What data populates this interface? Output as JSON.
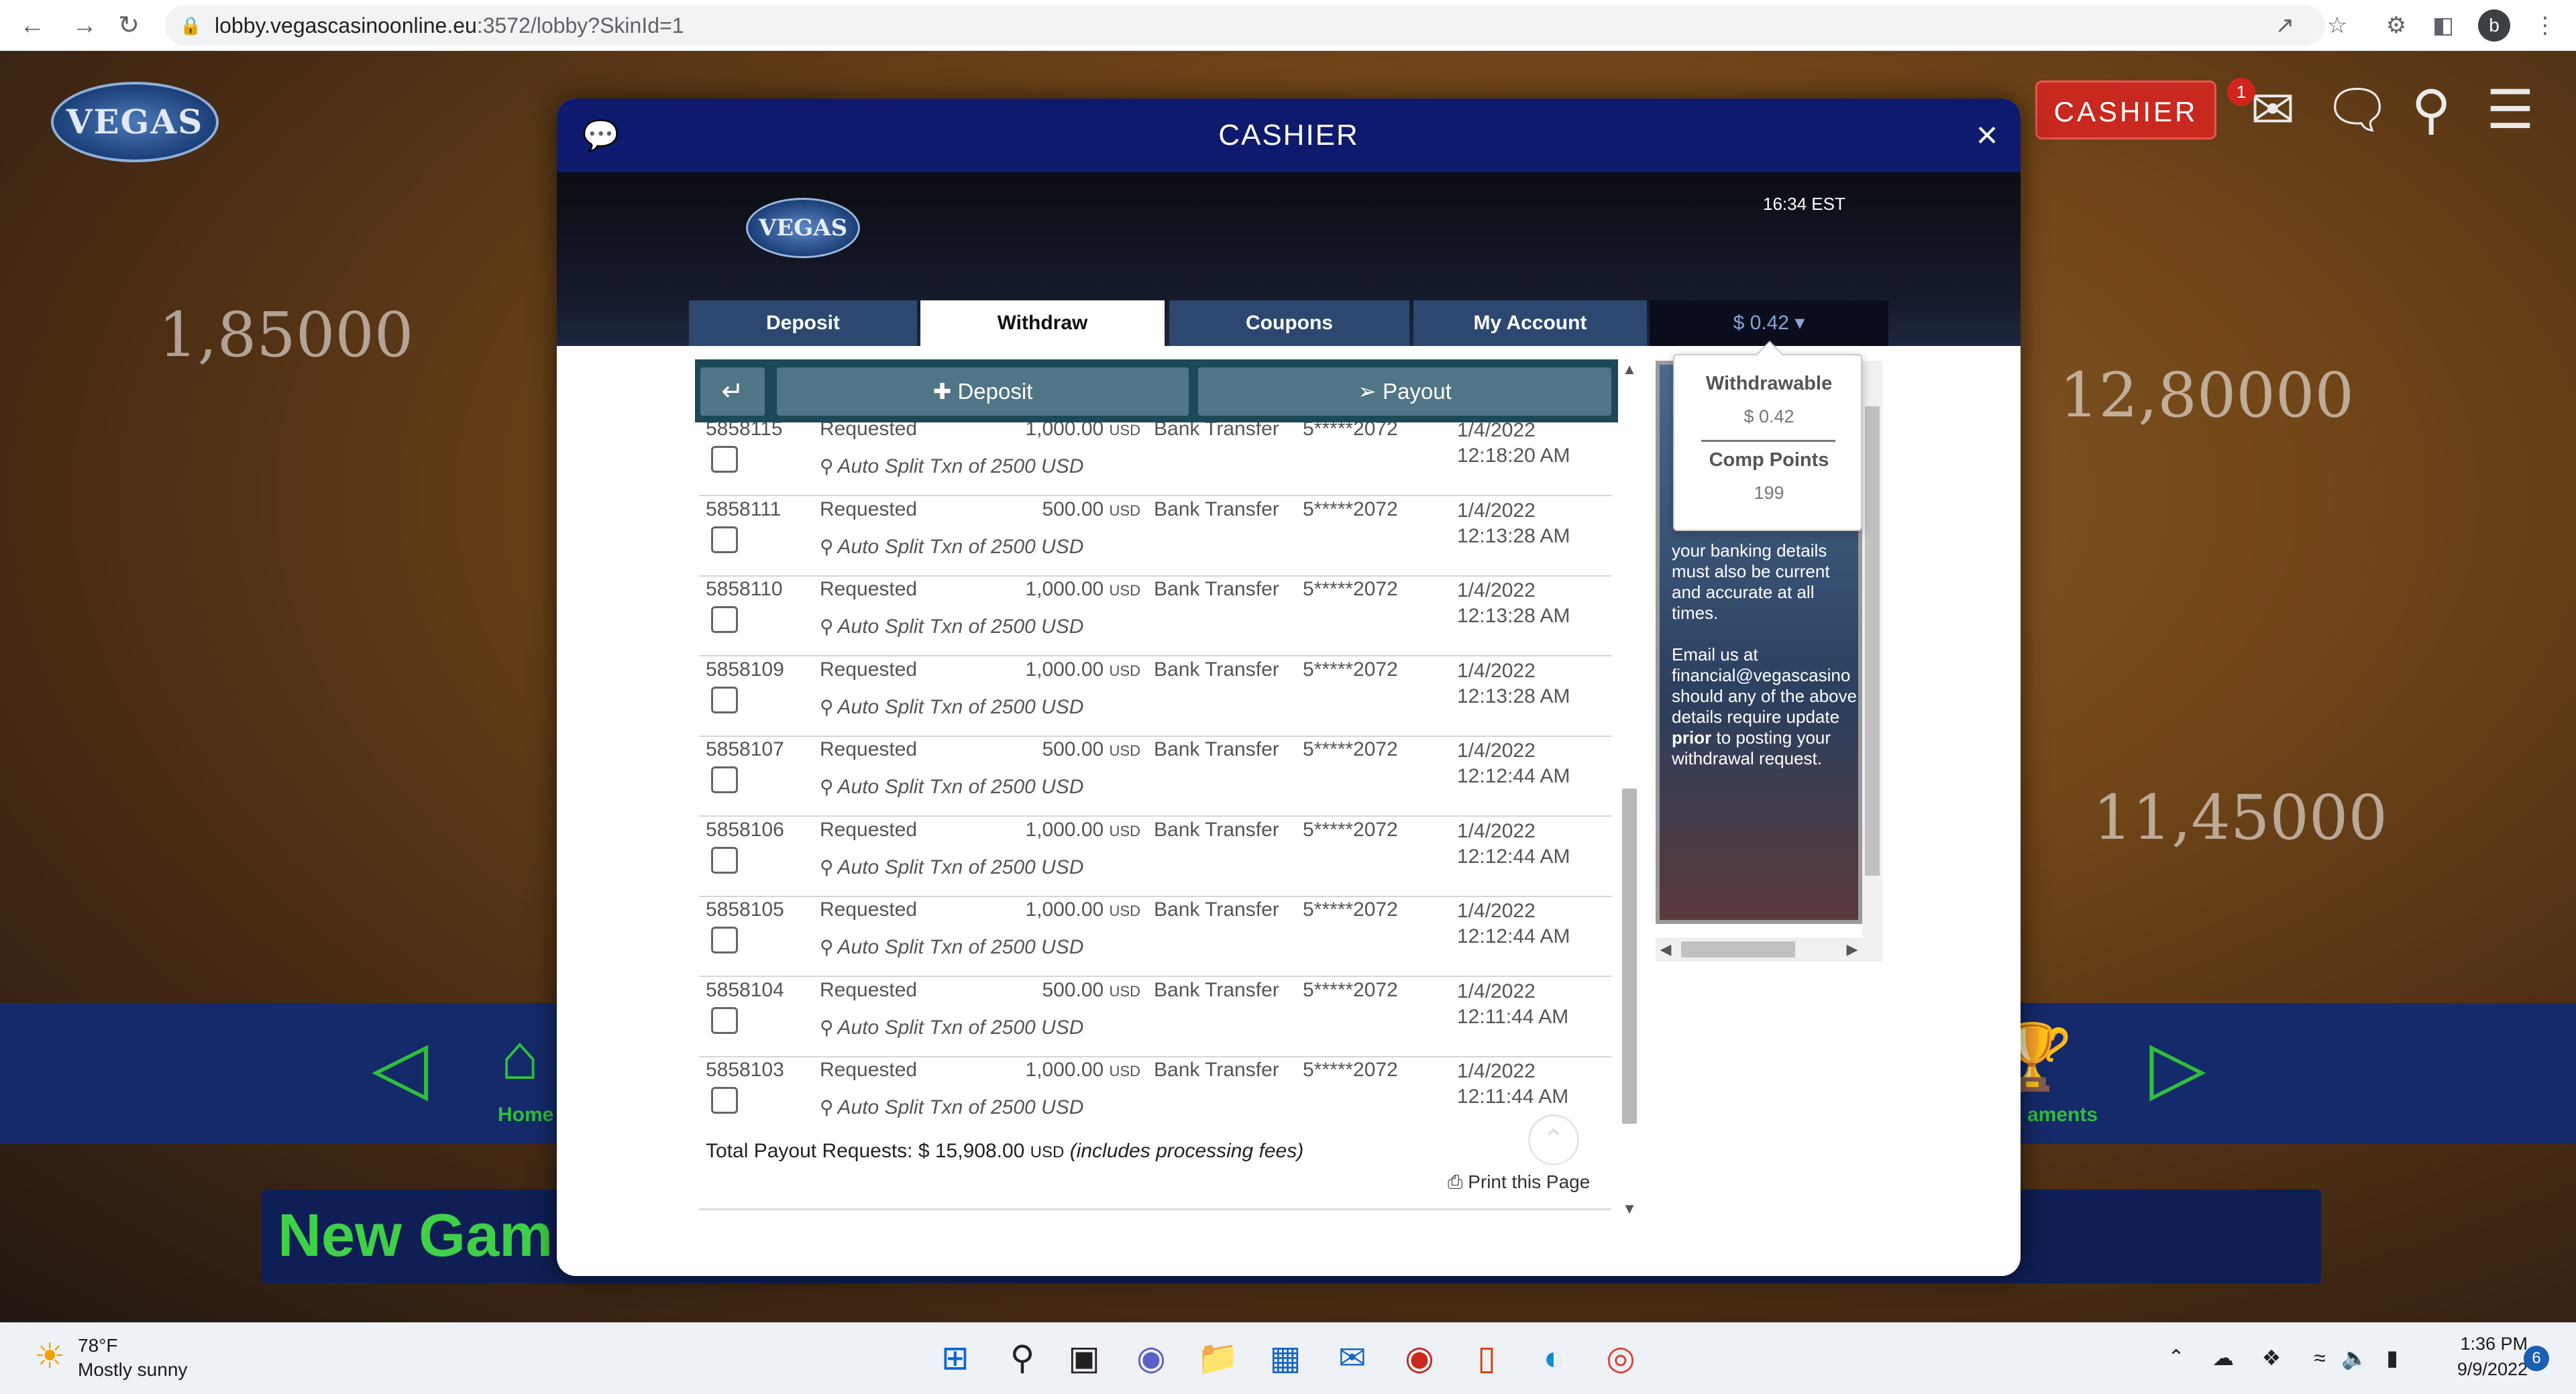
{
  "browser": {
    "url_host": "lobby.vegascasinoonline.eu",
    "url_rest": ":3572/lobby?SkinId=1",
    "profile_initial": "b"
  },
  "lobby": {
    "logo_text": "VEGAS",
    "cashier_label": "CASHIER",
    "message_count": "1",
    "slot_values": [
      "1,85000",
      "12,80000",
      "11,45000"
    ],
    "nav_labels": [
      "Home",
      "aments"
    ],
    "new_games_label": "New Gam"
  },
  "modal": {
    "title": "CASHIER",
    "time": "16:34 EST",
    "logo_text": "VEGAS",
    "tabs": [
      "Deposit",
      "Withdraw",
      "Coupons",
      "My Account"
    ],
    "active_tab": "Withdraw",
    "balance_label": "$ 0.42",
    "toolbar": {
      "deposit_label": "Deposit",
      "payout_label": "Payout"
    },
    "transactions": [
      {
        "id": "5858115",
        "status": "Requested",
        "amount": "1,000.00",
        "currency": "USD",
        "method": "Bank Transfer",
        "account": "5*****2072",
        "date": "1/4/2022",
        "time": "12:18:20 AM",
        "note": "Auto Split Txn of 2500 USD"
      },
      {
        "id": "5858111",
        "status": "Requested",
        "amount": "500.00",
        "currency": "USD",
        "method": "Bank Transfer",
        "account": "5*****2072",
        "date": "1/4/2022",
        "time": "12:13:28 AM",
        "note": "Auto Split Txn of 2500 USD"
      },
      {
        "id": "5858110",
        "status": "Requested",
        "amount": "1,000.00",
        "currency": "USD",
        "method": "Bank Transfer",
        "account": "5*****2072",
        "date": "1/4/2022",
        "time": "12:13:28 AM",
        "note": "Auto Split Txn of 2500 USD"
      },
      {
        "id": "5858109",
        "status": "Requested",
        "amount": "1,000.00",
        "currency": "USD",
        "method": "Bank Transfer",
        "account": "5*****2072",
        "date": "1/4/2022",
        "time": "12:13:28 AM",
        "note": "Auto Split Txn of 2500 USD"
      },
      {
        "id": "5858107",
        "status": "Requested",
        "amount": "500.00",
        "currency": "USD",
        "method": "Bank Transfer",
        "account": "5*****2072",
        "date": "1/4/2022",
        "time": "12:12:44 AM",
        "note": "Auto Split Txn of 2500 USD"
      },
      {
        "id": "5858106",
        "status": "Requested",
        "amount": "1,000.00",
        "currency": "USD",
        "method": "Bank Transfer",
        "account": "5*****2072",
        "date": "1/4/2022",
        "time": "12:12:44 AM",
        "note": "Auto Split Txn of 2500 USD"
      },
      {
        "id": "5858105",
        "status": "Requested",
        "amount": "1,000.00",
        "currency": "USD",
        "method": "Bank Transfer",
        "account": "5*****2072",
        "date": "1/4/2022",
        "time": "12:12:44 AM",
        "note": "Auto Split Txn of 2500 USD"
      },
      {
        "id": "5858104",
        "status": "Requested",
        "amount": "500.00",
        "currency": "USD",
        "method": "Bank Transfer",
        "account": "5*****2072",
        "date": "1/4/2022",
        "time": "12:11:44 AM",
        "note": "Auto Split Txn of 2500 USD"
      },
      {
        "id": "5858103",
        "status": "Requested",
        "amount": "1,000.00",
        "currency": "USD",
        "method": "Bank Transfer",
        "account": "5*****2072",
        "date": "1/4/2022",
        "time": "12:11:44 AM",
        "note": "Auto Split Txn of 2500 USD"
      }
    ],
    "totals": {
      "label": "Total Payout Requests: $ 15,908.00",
      "currency": "USD",
      "note": "(includes processing fees)"
    },
    "print_label": "Print this Page",
    "info_text_1": "your banking details must also be current and accurate at all times.",
    "info_text_2a": "Email us at financial@vegascasino should any of the above details require update",
    "info_text_2b": "prior",
    "info_text_2c": "to posting your withdrawal request.",
    "popover": {
      "withdrawable_label": "Withdrawable",
      "withdrawable_value": "$ 0.42",
      "comp_label": "Comp Points",
      "comp_value": "199"
    }
  },
  "taskbar": {
    "weather_temp": "78°F",
    "weather_desc": "Mostly sunny",
    "time": "1:36 PM",
    "date": "9/9/2022",
    "notifications": "6"
  },
  "colors": {
    "modal_header": "#0e1a6e",
    "tab_inactive": "#2c4870",
    "toolbar": "#1d4858",
    "cashier_red": "#c8281e",
    "lobby_green": "#2fbf3a"
  }
}
